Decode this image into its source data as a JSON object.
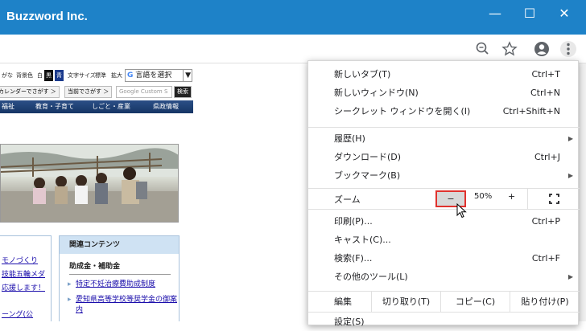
{
  "window": {
    "title": "Buzzword Inc.",
    "minimize": "—",
    "maximize": "☐",
    "close": "✕"
  },
  "toolbar_icons": [
    "zoom-out-icon",
    "star-icon",
    "profile-icon",
    "more-vert-icon"
  ],
  "page": {
    "access_strip": {
      "items": [
        "がな",
        "背景色",
        "白",
        "黒",
        "青",
        "文字サイズ",
        "標準",
        "拡大"
      ],
      "translate_label": "言語を選択",
      "translate_arrow": "▼"
    },
    "search_strip": {
      "calendar_btn": "カレンダーでさがす ＞",
      "dept_btn": "当前でさがす ＞",
      "search_placeholder": "Google Custom S",
      "search_btn": "検索"
    },
    "nav": [
      "福祉",
      "教育・子育て",
      "しごと・産業",
      "県政情報"
    ],
    "side_box": {
      "header": "関連コンテンツ",
      "subheader": "助成金・補助金",
      "links": [
        "特定不妊治療費助成制度",
        "愛知県高等学校等奨学金の御案内"
      ]
    },
    "left_links": [
      "モノづくり",
      "技能五輪メダ",
      "応援します！",
      "",
      "ーング(公"
    ]
  },
  "menu": {
    "items": [
      {
        "label": "新しいタブ(T)",
        "shortcut": "Ctrl+T"
      },
      {
        "label": "新しいウィンドウ(N)",
        "shortcut": "Ctrl+N"
      },
      {
        "label": "シークレット ウィンドウを開く(I)",
        "shortcut": "Ctrl+Shift+N"
      },
      {
        "label": "履歴(H)",
        "shortcut": ""
      },
      {
        "label": "ダウンロード(D)",
        "shortcut": "Ctrl+J"
      },
      {
        "label": "ブックマーク(B)",
        "shortcut": ""
      },
      {
        "label": "印刷(P)...",
        "shortcut": "Ctrl+P"
      },
      {
        "label": "キャスト(C)...",
        "shortcut": ""
      },
      {
        "label": "検索(F)...",
        "shortcut": "Ctrl+F"
      },
      {
        "label": "その他のツール(L)",
        "shortcut": ""
      }
    ],
    "zoom": {
      "label": "ズーム",
      "minus": "−",
      "value": "50%",
      "plus": "+"
    },
    "edit": {
      "label": "編集",
      "cut": "切り取り(T)",
      "copy": "コピー(C)",
      "paste": "貼り付け(P)"
    },
    "settings_partial": "設定(S)"
  }
}
